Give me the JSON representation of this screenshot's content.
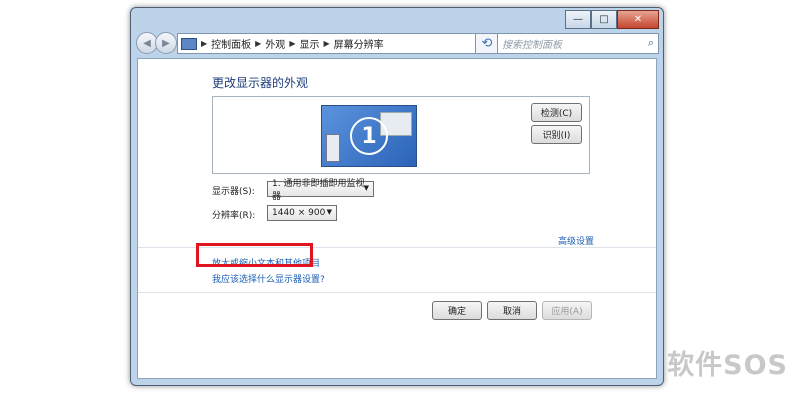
{
  "window": {
    "minimize": "—",
    "maximize": "□",
    "close": "✕"
  },
  "nav": {
    "back": "◀",
    "forward": "▶"
  },
  "address": {
    "breadcrumbs": [
      "控制面板",
      "外观",
      "显示",
      "屏幕分辨率"
    ]
  },
  "search": {
    "placeholder": "搜索控制面板"
  },
  "main": {
    "heading": "更改显示器的外观",
    "monitor_number": "1",
    "detect_button": "检测(C)",
    "identify_button": "识别(I)",
    "display_label": "显示器(S):",
    "display_value": "1. 通用非即插即用监视器",
    "resolution_label": "分辨率(R):",
    "resolution_value": "1440 × 900",
    "advanced_link": "高级设置",
    "text_size_link": "放大或缩小文本和其他项目",
    "help_link": "我应该选择什么显示器设置?"
  },
  "footer": {
    "ok_button": "确定",
    "cancel_button": "取消",
    "apply_button": "应用(A)"
  },
  "watermark": {
    "text": "软件SOS"
  },
  "colors": {
    "highlight": "#e0141c",
    "link": "#1b5fb5",
    "heading": "#1e3d79"
  }
}
